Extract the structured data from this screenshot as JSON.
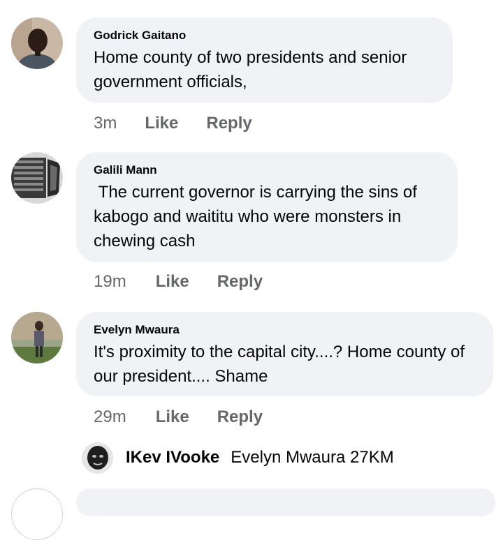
{
  "comments": [
    {
      "author": "Godrick Gaitano",
      "text": "Home county of two presidents and senior government officials,",
      "time": "3m",
      "like": "Like",
      "reply": "Reply"
    },
    {
      "author": "Galili Mann",
      "text": " The current governor is carrying the sins of kabogo and waititu who were monsters in chewing cash",
      "time": "19m",
      "like": "Like",
      "reply": "Reply"
    },
    {
      "author": "Evelyn Mwaura",
      "text": "It's proximity to the capital city....? Home county of our president.... Shame",
      "time": "29m",
      "like": "Like",
      "reply": "Reply"
    }
  ],
  "reply_preview": {
    "author": "IKev IVooke",
    "text": "Evelyn Mwaura 27KM"
  },
  "colors": {
    "bubble": "#f0f2f5",
    "meta_text": "#65676b",
    "body_text": "#050505"
  }
}
